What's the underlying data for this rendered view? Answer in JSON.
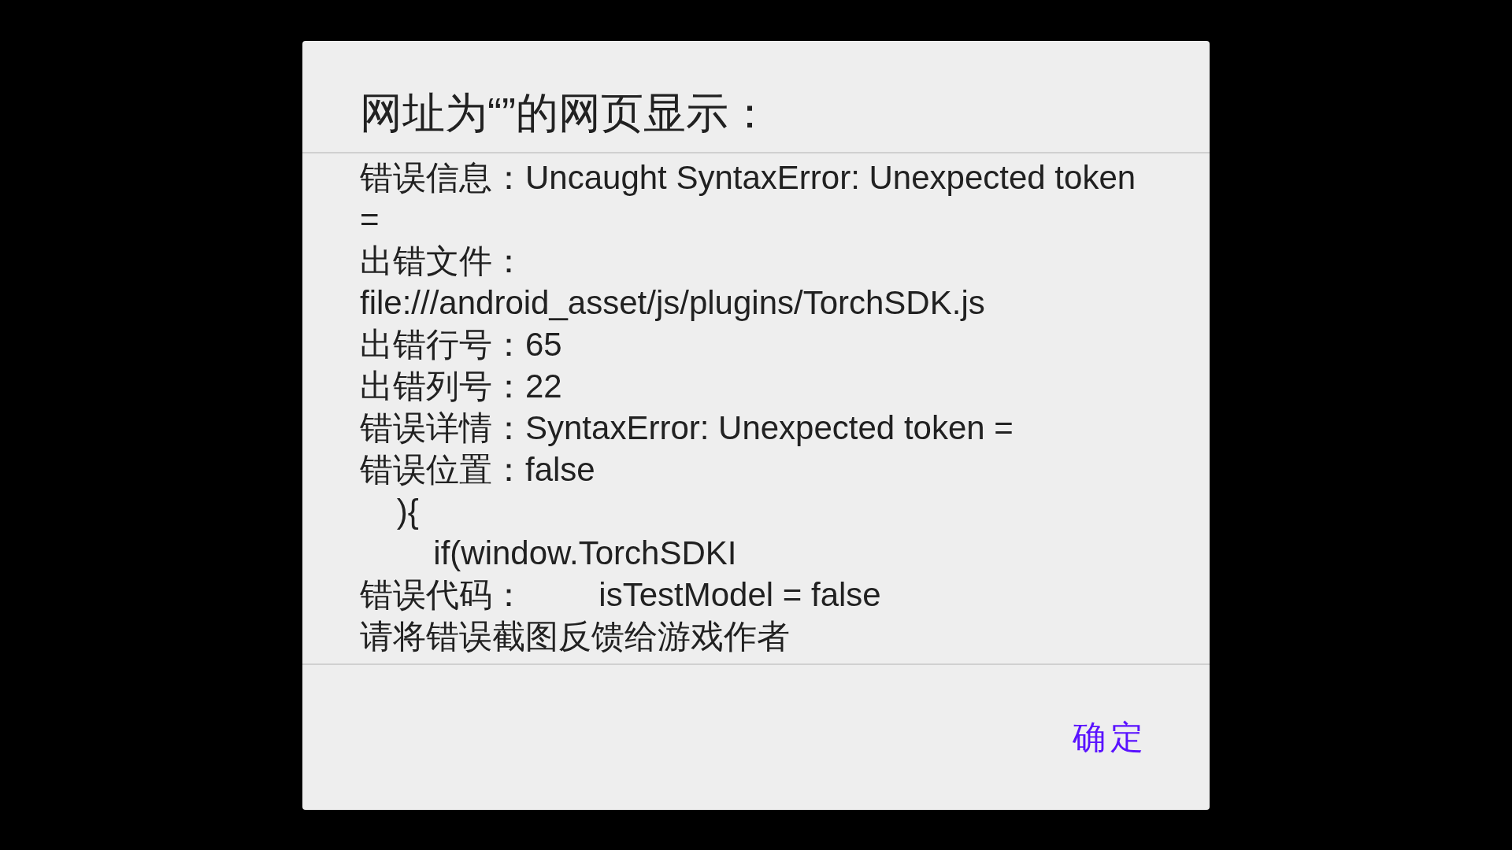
{
  "dialog": {
    "title": "网址为“”的网页显示：",
    "message_lines": [
      "错误信息：Uncaught SyntaxError: Unexpected token =",
      "出错文件：file:///android_asset/js/plugins/TorchSDK.js",
      "出错行号：65",
      "出错列号：22",
      "错误详情：SyntaxError: Unexpected token =",
      "错误位置：false",
      "    ){",
      "        if(window.TorchSDKI",
      "错误代码：        isTestModel = false",
      "请将错误截图反馈给游戏作者"
    ],
    "buttons": [
      {
        "label": "确定",
        "kind": "text"
      }
    ]
  }
}
